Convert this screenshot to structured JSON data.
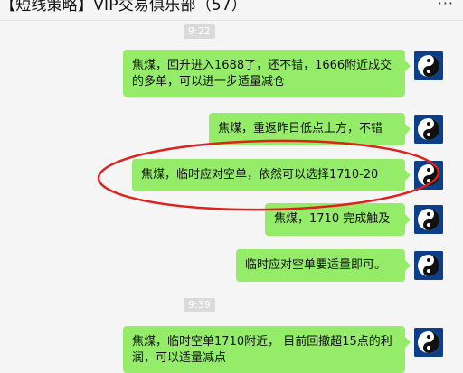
{
  "window": {
    "title": "【短线策略】VIP交易俱乐部（57）",
    "more_icon": "more-dots-icon"
  },
  "timestamps": [
    "9:22",
    "9:39"
  ],
  "messages": [
    {
      "text": "焦煤，回升进入1688了，还不错，1666附近成交的多单，可以进一步适量减仓"
    },
    {
      "text": "焦煤，重返昨日低点上方，不错"
    },
    {
      "text": "焦煤，临时应对空单，依然可以选择1710-20"
    },
    {
      "text": "焦煤，1710 完成触及"
    },
    {
      "text": "临时应对空单要适量即可。"
    },
    {
      "text": "焦煤，临时空单1710附近， 目前回撤超15点的利润，可以适量减点"
    }
  ],
  "annotation": {
    "color": "#e0201a"
  },
  "colors": {
    "bubble": "#95ec69",
    "background": "#f5f5f5"
  }
}
